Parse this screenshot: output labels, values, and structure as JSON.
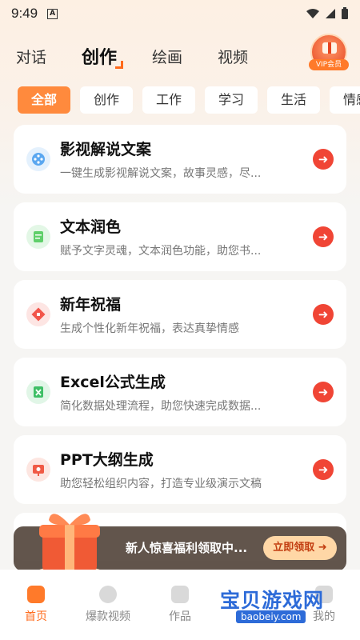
{
  "status": {
    "time": "9:49",
    "indicator": "A"
  },
  "top_tabs": [
    {
      "label": "对话"
    },
    {
      "label": "创作"
    },
    {
      "label": "绘画"
    },
    {
      "label": "视频"
    }
  ],
  "vip": {
    "label": "VIP会员"
  },
  "filters": [
    {
      "label": "全部"
    },
    {
      "label": "创作"
    },
    {
      "label": "工作"
    },
    {
      "label": "学习"
    },
    {
      "label": "生活"
    },
    {
      "label": "情感"
    }
  ],
  "cards": [
    {
      "title": "影视解说文案",
      "desc": "一键生成影视解说文案，故事灵感，尽...",
      "icon": "film-reel-icon",
      "color": "#5aa7f0"
    },
    {
      "title": "文本润色",
      "desc": "赋予文字灵魂，文本润色功能，助您书...",
      "icon": "document-icon",
      "color": "#5fcf6a"
    },
    {
      "title": "新年祝福",
      "desc": "生成个性化新年祝福，表达真挚情感",
      "icon": "blessing-icon",
      "color": "#f2554a"
    },
    {
      "title": "Excel公式生成",
      "desc": "简化数据处理流程，助您快速完成数据...",
      "icon": "spreadsheet-icon",
      "color": "#3fbf66"
    },
    {
      "title": "PPT大纲生成",
      "desc": "助您轻松组织内容，打造专业级演示文稿",
      "icon": "presentation-icon",
      "color": "#f05a45"
    }
  ],
  "promo": {
    "text": "新人惊喜福利领取中...",
    "button": "立即领取 ➜"
  },
  "bottom_nav": [
    {
      "label": "首页"
    },
    {
      "label": "爆款视频"
    },
    {
      "label": "作品"
    },
    {
      "label": ""
    },
    {
      "label": "我的"
    }
  ],
  "watermark": {
    "title": "宝贝游戏网",
    "url": "baobeiy.com"
  }
}
